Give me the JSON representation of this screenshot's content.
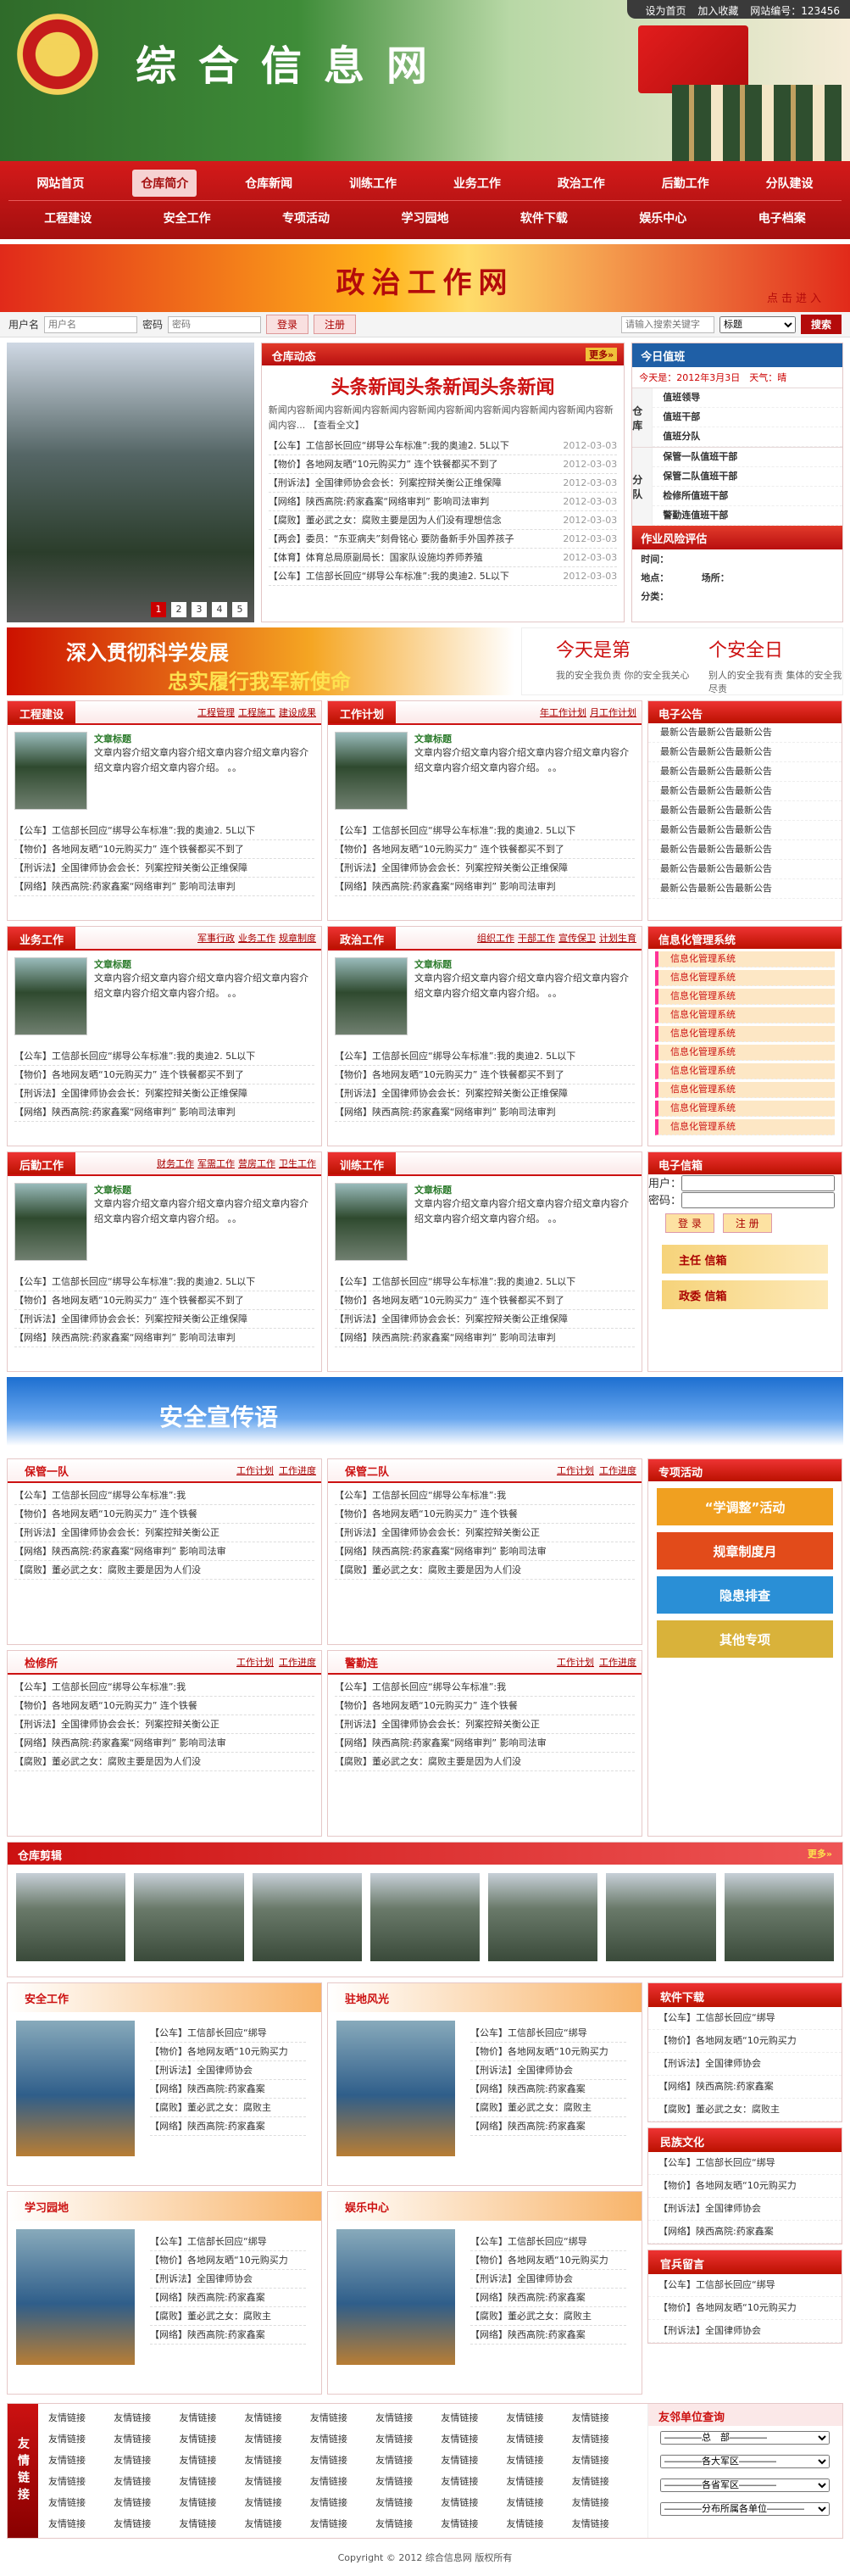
{
  "topbar": {
    "home": "设为首页",
    "fav": "加入收藏",
    "visits_label": "网站编号：123456"
  },
  "site_title": "综合信息网",
  "nav": {
    "row1": [
      "网站首页",
      "仓库简介",
      "仓库新闻",
      "训练工作",
      "业务工作",
      "政治工作",
      "后勤工作",
      "分队建设"
    ],
    "row2": [
      "工程建设",
      "安全工作",
      "专项活动",
      "学习园地",
      "软件下载",
      "娱乐中心",
      "电子档案"
    ],
    "active": "仓库简介"
  },
  "banner": {
    "title": "政治工作网",
    "enter": "点击进入"
  },
  "login": {
    "user_label": "用户名",
    "user_ph": "用户名",
    "pass_label": "密码",
    "pass_ph": "密码",
    "login": "登录",
    "register": "注册",
    "search_ph": "请输入搜索关键字",
    "select": "标题",
    "search": "搜索"
  },
  "photo_pages": [
    "1",
    "2",
    "3",
    "4",
    "5"
  ],
  "news": {
    "title": "仓库动态",
    "more": "更多»",
    "headline": "头条新闻头条新闻头条新闻",
    "summary": "新闻内容新闻内容新闻内容新闻内容新闻内容新闻内容新闻内容新闻内容新闻内容新闻内容...",
    "readall": "【查看全文】",
    "items": [
      {
        "t": "【公车】工信部长回应“绑导公车标准”:我的奥迪2. 5L以下",
        "d": "2012-03-03"
      },
      {
        "t": "【物价】各地网友晒“10元购买力” 连个铁餐都买不到了",
        "d": "2012-03-03"
      },
      {
        "t": "【刑诉法】全国律师协会会长：列案控辩关衡公正维保障",
        "d": "2012-03-03"
      },
      {
        "t": "【网络】陕西高院:药家鑫案“网络审判” 影响司法审判",
        "d": "2012-03-03"
      },
      {
        "t": "【腐败】董必武之女：腐败主要是因为人们没有理想信念",
        "d": "2012-03-03"
      },
      {
        "t": "【两会】委员：“东亚病夫”刻骨铭心 要防备新手外国养孩子",
        "d": "2012-03-03"
      },
      {
        "t": "【体育】体育总局原副局长：国家队设施均养师养殖",
        "d": "2012-03-03"
      },
      {
        "t": "【公车】工信部长回应“绑导公车标准”:我的奥迪2. 5L以下",
        "d": "2012-03-03"
      }
    ]
  },
  "today": {
    "title": "今日值班",
    "date": "今天是：2012年3月3日　天气：晴",
    "groups": [
      {
        "k": "仓库",
        "items": [
          "值班领导",
          "值班干部",
          "值班分队"
        ]
      },
      {
        "k": "分队",
        "items": [
          "保管一队值班干部",
          "保管二队值班干部",
          "检修所值班干部",
          "警勤连值班干部"
        ]
      }
    ],
    "risk_title": "作业风险评估",
    "risk": [
      "时间：",
      "地点：　　　　场所：",
      "分类："
    ]
  },
  "motto": {
    "a": "深入贯彻科学发展",
    "b": "忠实履行我军新使命",
    "c": "今天是第",
    "d": "个安全日",
    "e": "我的安全我负责\n你的安全我关心",
    "f": "别人的安全我有责\n集体的安全我尽责"
  },
  "modules": [
    {
      "title": "工程建设",
      "links": [
        "工程管理",
        "工程施工",
        "建设成果"
      ]
    },
    {
      "title": "工作计划",
      "links": [
        "年工作计划",
        "月工作计划"
      ]
    },
    {
      "title": "业务工作",
      "links": [
        "军事行政",
        "业务工作",
        "规章制度"
      ]
    },
    {
      "title": "政治工作",
      "links": [
        "组织工作",
        "干部工作",
        "宣传保卫",
        "计划生育"
      ]
    },
    {
      "title": "后勤工作",
      "links": [
        "财务工作",
        "军需工作",
        "营房工作",
        "卫生工作"
      ]
    },
    {
      "title": "训练工作",
      "links": []
    }
  ],
  "module_body": {
    "caption": "文章标题",
    "text": "文章内容介绍文章内容介绍文章内容介绍文章内容介绍文章内容介绍文章内容介绍。 。。"
  },
  "module_items": [
    "【公车】工信部长回应“绑导公车标准”:我的奥迪2. 5L以下",
    "【物价】各地网友晒“10元购买力” 连个铁餐都买不到了",
    "【刑诉法】全国律师协会会长：列案控辩关衡公正维保障",
    "【网络】陕西高院:药家鑫案“网络审判” 影响司法审判"
  ],
  "notice": {
    "title": "电子公告",
    "items": [
      "最新公告最新公告最新公告",
      "最新公告最新公告最新公告",
      "最新公告最新公告最新公告",
      "最新公告最新公告最新公告",
      "最新公告最新公告最新公告",
      "最新公告最新公告最新公告",
      "最新公告最新公告最新公告",
      "最新公告最新公告最新公告",
      "最新公告最新公告最新公告"
    ]
  },
  "sys": {
    "title": "信息化管理系统",
    "items": [
      "信息化管理系统",
      "信息化管理系统",
      "信息化管理系统",
      "信息化管理系统",
      "信息化管理系统",
      "信息化管理系统",
      "信息化管理系统",
      "信息化管理系统",
      "信息化管理系统",
      "信息化管理系统"
    ]
  },
  "mail": {
    "title": "电子信箱",
    "user": "用户：",
    "pass": "密码：",
    "login": "登 录",
    "register": "注 册",
    "m1": "主任 信箱",
    "m2": "政委 信箱"
  },
  "safety": "安全宣传语",
  "bmods": [
    {
      "title": "保管一队",
      "links": [
        "工作计划",
        "工作进度"
      ]
    },
    {
      "title": "保管二队",
      "links": [
        "工作计划",
        "工作进度"
      ]
    },
    {
      "title": "检修所",
      "links": [
        "工作计划",
        "工作进度"
      ]
    },
    {
      "title": "警勤连",
      "links": [
        "工作计划",
        "工作进度"
      ]
    }
  ],
  "bitems": [
    "【公车】工信部长回应“绑导公车标准”:我",
    "【物价】各地网友晒“10元购买力” 连个铁餐",
    "【刑诉法】全国律师协会会长：列案控辩关衡公正",
    "【网络】陕西高院:药家鑫案“网络审判” 影响司法审",
    "【腐败】董必武之女：腐败主要是因为人们没"
  ],
  "special": {
    "title": "专项活动",
    "items": [
      "“学调整”活动",
      "规章制度月",
      "隐患排查",
      "其他专项"
    ]
  },
  "camp": {
    "title": "仓库剪辑",
    "more": "更多»"
  },
  "lmods": [
    {
      "title": "安全工作"
    },
    {
      "title": "驻地风光"
    },
    {
      "title": "学习园地"
    },
    {
      "title": "娱乐中心"
    }
  ],
  "litems": [
    "【公车】工信部长回应“绑导",
    "【物价】各地网友晒“10元购买力",
    "【刑诉法】全国律师协会",
    "【网络】陕西高院:药家鑫案",
    "【腐败】董必武之女：腐败主",
    "【网络】陕西高院:药家鑫案"
  ],
  "rsides": [
    {
      "title": "软件下载",
      "items": [
        "【公车】工信部长回应“绑导",
        "【物价】各地网友晒“10元购买力",
        "【刑诉法】全国律师协会",
        "【网络】陕西高院:药家鑫案",
        "【腐败】董必武之女：腐败主"
      ]
    },
    {
      "title": "民族文化",
      "items": [
        "【公车】工信部长回应“绑导",
        "【物价】各地网友晒“10元购买力",
        "【刑诉法】全国律师协会",
        "【网络】陕西高院:药家鑫案"
      ]
    },
    {
      "title": "官兵留言",
      "items": [
        "【公车】工信部长回应“绑导",
        "【物价】各地网友晒“10元购买力",
        "【刑诉法】全国律师协会"
      ]
    }
  ],
  "friends": {
    "label": "友情链接",
    "item": "友情链接",
    "depts_title": "友邻单位查询",
    "selects": [
      "————总　部————",
      "————各大军区————",
      "————各省军区————",
      "————分布所属各单位————"
    ]
  },
  "footer": "Copyright © 2012 综合信息网 版权所有"
}
